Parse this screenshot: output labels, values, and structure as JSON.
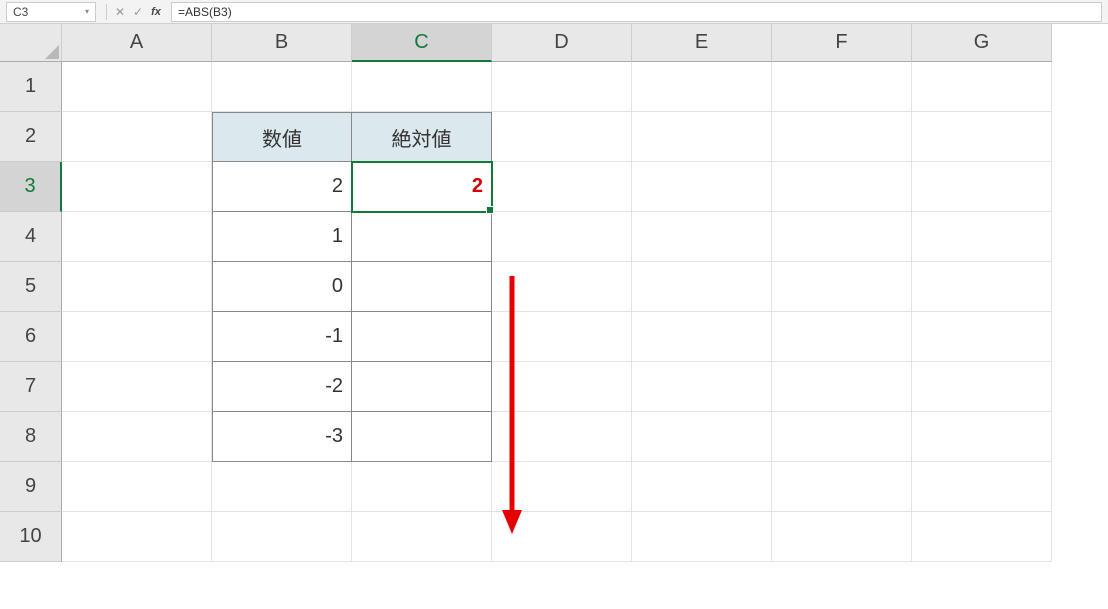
{
  "name_box": "C3",
  "formula": "=ABS(B3)",
  "columns": [
    "A",
    "B",
    "C",
    "D",
    "E",
    "F",
    "G"
  ],
  "rows": [
    "1",
    "2",
    "3",
    "4",
    "5",
    "6",
    "7",
    "8",
    "9",
    "10"
  ],
  "active_col": "C",
  "active_row": "3",
  "table": {
    "headers": {
      "B": "数値",
      "C": "絶対値"
    },
    "data": {
      "B3": "2",
      "C3": "2",
      "B4": "1",
      "B5": "0",
      "B6": "-1",
      "B7": "-2",
      "B8": "-3"
    }
  }
}
